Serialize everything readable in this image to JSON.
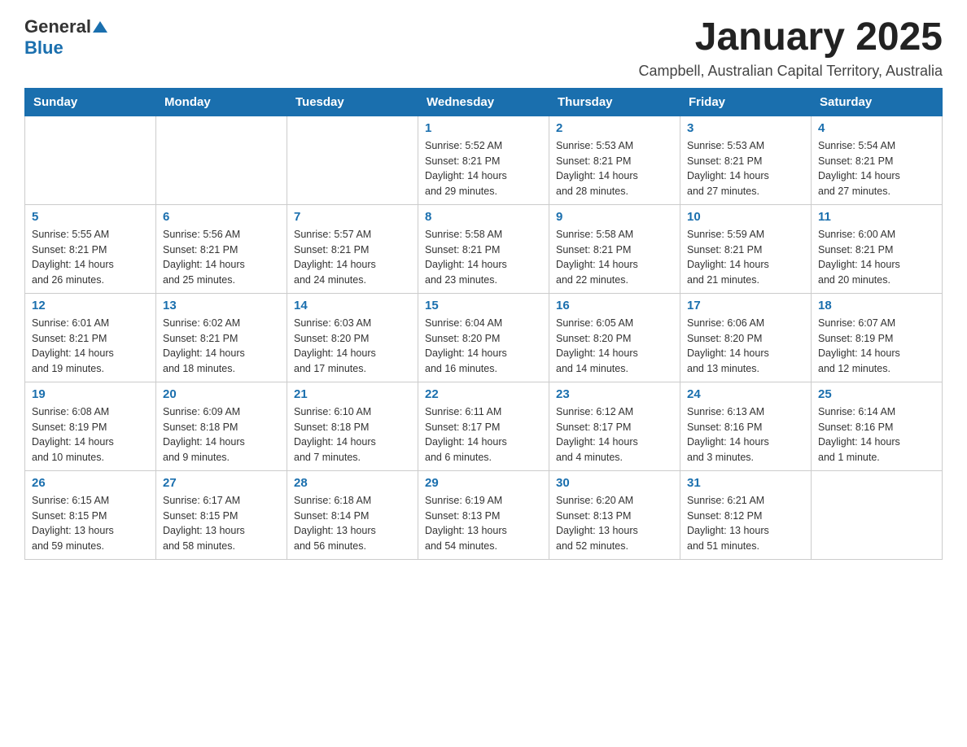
{
  "header": {
    "logo_general": "General",
    "logo_blue": "Blue",
    "month_title": "January 2025",
    "location": "Campbell, Australian Capital Territory, Australia"
  },
  "days_of_week": [
    "Sunday",
    "Monday",
    "Tuesday",
    "Wednesday",
    "Thursday",
    "Friday",
    "Saturday"
  ],
  "weeks": [
    [
      {
        "day": "",
        "info": ""
      },
      {
        "day": "",
        "info": ""
      },
      {
        "day": "",
        "info": ""
      },
      {
        "day": "1",
        "info": "Sunrise: 5:52 AM\nSunset: 8:21 PM\nDaylight: 14 hours\nand 29 minutes."
      },
      {
        "day": "2",
        "info": "Sunrise: 5:53 AM\nSunset: 8:21 PM\nDaylight: 14 hours\nand 28 minutes."
      },
      {
        "day": "3",
        "info": "Sunrise: 5:53 AM\nSunset: 8:21 PM\nDaylight: 14 hours\nand 27 minutes."
      },
      {
        "day": "4",
        "info": "Sunrise: 5:54 AM\nSunset: 8:21 PM\nDaylight: 14 hours\nand 27 minutes."
      }
    ],
    [
      {
        "day": "5",
        "info": "Sunrise: 5:55 AM\nSunset: 8:21 PM\nDaylight: 14 hours\nand 26 minutes."
      },
      {
        "day": "6",
        "info": "Sunrise: 5:56 AM\nSunset: 8:21 PM\nDaylight: 14 hours\nand 25 minutes."
      },
      {
        "day": "7",
        "info": "Sunrise: 5:57 AM\nSunset: 8:21 PM\nDaylight: 14 hours\nand 24 minutes."
      },
      {
        "day": "8",
        "info": "Sunrise: 5:58 AM\nSunset: 8:21 PM\nDaylight: 14 hours\nand 23 minutes."
      },
      {
        "day": "9",
        "info": "Sunrise: 5:58 AM\nSunset: 8:21 PM\nDaylight: 14 hours\nand 22 minutes."
      },
      {
        "day": "10",
        "info": "Sunrise: 5:59 AM\nSunset: 8:21 PM\nDaylight: 14 hours\nand 21 minutes."
      },
      {
        "day": "11",
        "info": "Sunrise: 6:00 AM\nSunset: 8:21 PM\nDaylight: 14 hours\nand 20 minutes."
      }
    ],
    [
      {
        "day": "12",
        "info": "Sunrise: 6:01 AM\nSunset: 8:21 PM\nDaylight: 14 hours\nand 19 minutes."
      },
      {
        "day": "13",
        "info": "Sunrise: 6:02 AM\nSunset: 8:21 PM\nDaylight: 14 hours\nand 18 minutes."
      },
      {
        "day": "14",
        "info": "Sunrise: 6:03 AM\nSunset: 8:20 PM\nDaylight: 14 hours\nand 17 minutes."
      },
      {
        "day": "15",
        "info": "Sunrise: 6:04 AM\nSunset: 8:20 PM\nDaylight: 14 hours\nand 16 minutes."
      },
      {
        "day": "16",
        "info": "Sunrise: 6:05 AM\nSunset: 8:20 PM\nDaylight: 14 hours\nand 14 minutes."
      },
      {
        "day": "17",
        "info": "Sunrise: 6:06 AM\nSunset: 8:20 PM\nDaylight: 14 hours\nand 13 minutes."
      },
      {
        "day": "18",
        "info": "Sunrise: 6:07 AM\nSunset: 8:19 PM\nDaylight: 14 hours\nand 12 minutes."
      }
    ],
    [
      {
        "day": "19",
        "info": "Sunrise: 6:08 AM\nSunset: 8:19 PM\nDaylight: 14 hours\nand 10 minutes."
      },
      {
        "day": "20",
        "info": "Sunrise: 6:09 AM\nSunset: 8:18 PM\nDaylight: 14 hours\nand 9 minutes."
      },
      {
        "day": "21",
        "info": "Sunrise: 6:10 AM\nSunset: 8:18 PM\nDaylight: 14 hours\nand 7 minutes."
      },
      {
        "day": "22",
        "info": "Sunrise: 6:11 AM\nSunset: 8:17 PM\nDaylight: 14 hours\nand 6 minutes."
      },
      {
        "day": "23",
        "info": "Sunrise: 6:12 AM\nSunset: 8:17 PM\nDaylight: 14 hours\nand 4 minutes."
      },
      {
        "day": "24",
        "info": "Sunrise: 6:13 AM\nSunset: 8:16 PM\nDaylight: 14 hours\nand 3 minutes."
      },
      {
        "day": "25",
        "info": "Sunrise: 6:14 AM\nSunset: 8:16 PM\nDaylight: 14 hours\nand 1 minute."
      }
    ],
    [
      {
        "day": "26",
        "info": "Sunrise: 6:15 AM\nSunset: 8:15 PM\nDaylight: 13 hours\nand 59 minutes."
      },
      {
        "day": "27",
        "info": "Sunrise: 6:17 AM\nSunset: 8:15 PM\nDaylight: 13 hours\nand 58 minutes."
      },
      {
        "day": "28",
        "info": "Sunrise: 6:18 AM\nSunset: 8:14 PM\nDaylight: 13 hours\nand 56 minutes."
      },
      {
        "day": "29",
        "info": "Sunrise: 6:19 AM\nSunset: 8:13 PM\nDaylight: 13 hours\nand 54 minutes."
      },
      {
        "day": "30",
        "info": "Sunrise: 6:20 AM\nSunset: 8:13 PM\nDaylight: 13 hours\nand 52 minutes."
      },
      {
        "day": "31",
        "info": "Sunrise: 6:21 AM\nSunset: 8:12 PM\nDaylight: 13 hours\nand 51 minutes."
      },
      {
        "day": "",
        "info": ""
      }
    ]
  ]
}
